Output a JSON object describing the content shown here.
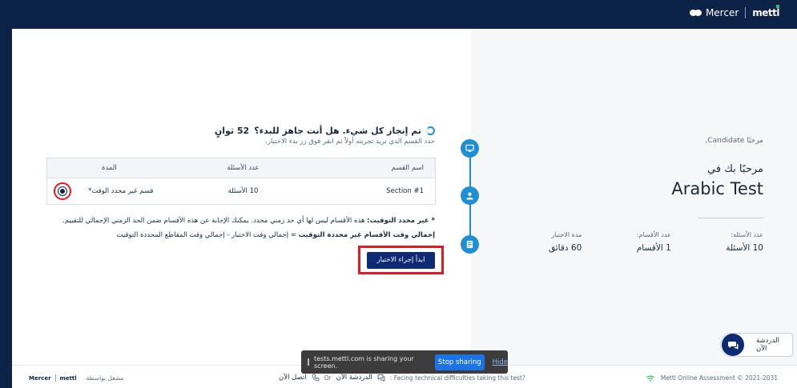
{
  "brand": {
    "name": "Mercer",
    "product": "mettl"
  },
  "main": {
    "ready_text": "تم إنجاز كل شيء. هل أنت جاهز للبدء؟",
    "countdown": "52 ثوانٍ",
    "hint": "حدد القسم الذي تريد تجربته أولاً ثم انقر فوق زر بدء الاختبار.",
    "table": {
      "headers": {
        "name": "اسم القسم",
        "questions": "عدد الأسئلة",
        "duration": "المدة"
      },
      "rows": [
        {
          "name": "Section #1",
          "questions": "10 الأسئلة",
          "duration": "قسم غير محدد الوقت*"
        }
      ]
    },
    "note1_bold": "* غير محدد التوقيت:",
    "note1_text": " هذه الأقسام ليس لها أي حد زمني محدد. يمكنك الإجابة عن هذه الأقسام ضمن الحد الزمني الإجمالي للتقييم.",
    "note2_bold": "إجمالي وقت الأقسام غير محددة التوقيت",
    "note2_text": " = إجمالي وقت الاختبار - إجمالي وقت المقاطع المحددة التوقيت",
    "start_button": "ابدأ إجراء الاختبار"
  },
  "sidebar": {
    "greeting": "مرحبًا Candidate,",
    "welcome": "مرحبًا بك في",
    "test_name": "Arabic Test",
    "stats": [
      {
        "label": "عدد الأسئلة:",
        "value": "10 الأسئلة"
      },
      {
        "label": "عدد الأقسام:",
        "value": "1 الأقسام"
      },
      {
        "label": "مدة الاختبار",
        "value": "60 دقائق"
      }
    ]
  },
  "chat": {
    "label": "الدردشة الآن"
  },
  "sharebar": {
    "message": "tests.mettl.com is sharing your screen.",
    "stop": "Stop sharing",
    "hide": "Hide"
  },
  "footer": {
    "logo_brand": "Mercer",
    "logo_product": "mettl",
    "powered_by": "مشغل بواسطة",
    "call_now": "اتصل الآن",
    "or": "Or",
    "chat_now": "الدردشة الآن",
    "facing": ": Facing technical difficulties taking this test?",
    "copyright": "Mettl Online Assessment © 2021-2031"
  }
}
